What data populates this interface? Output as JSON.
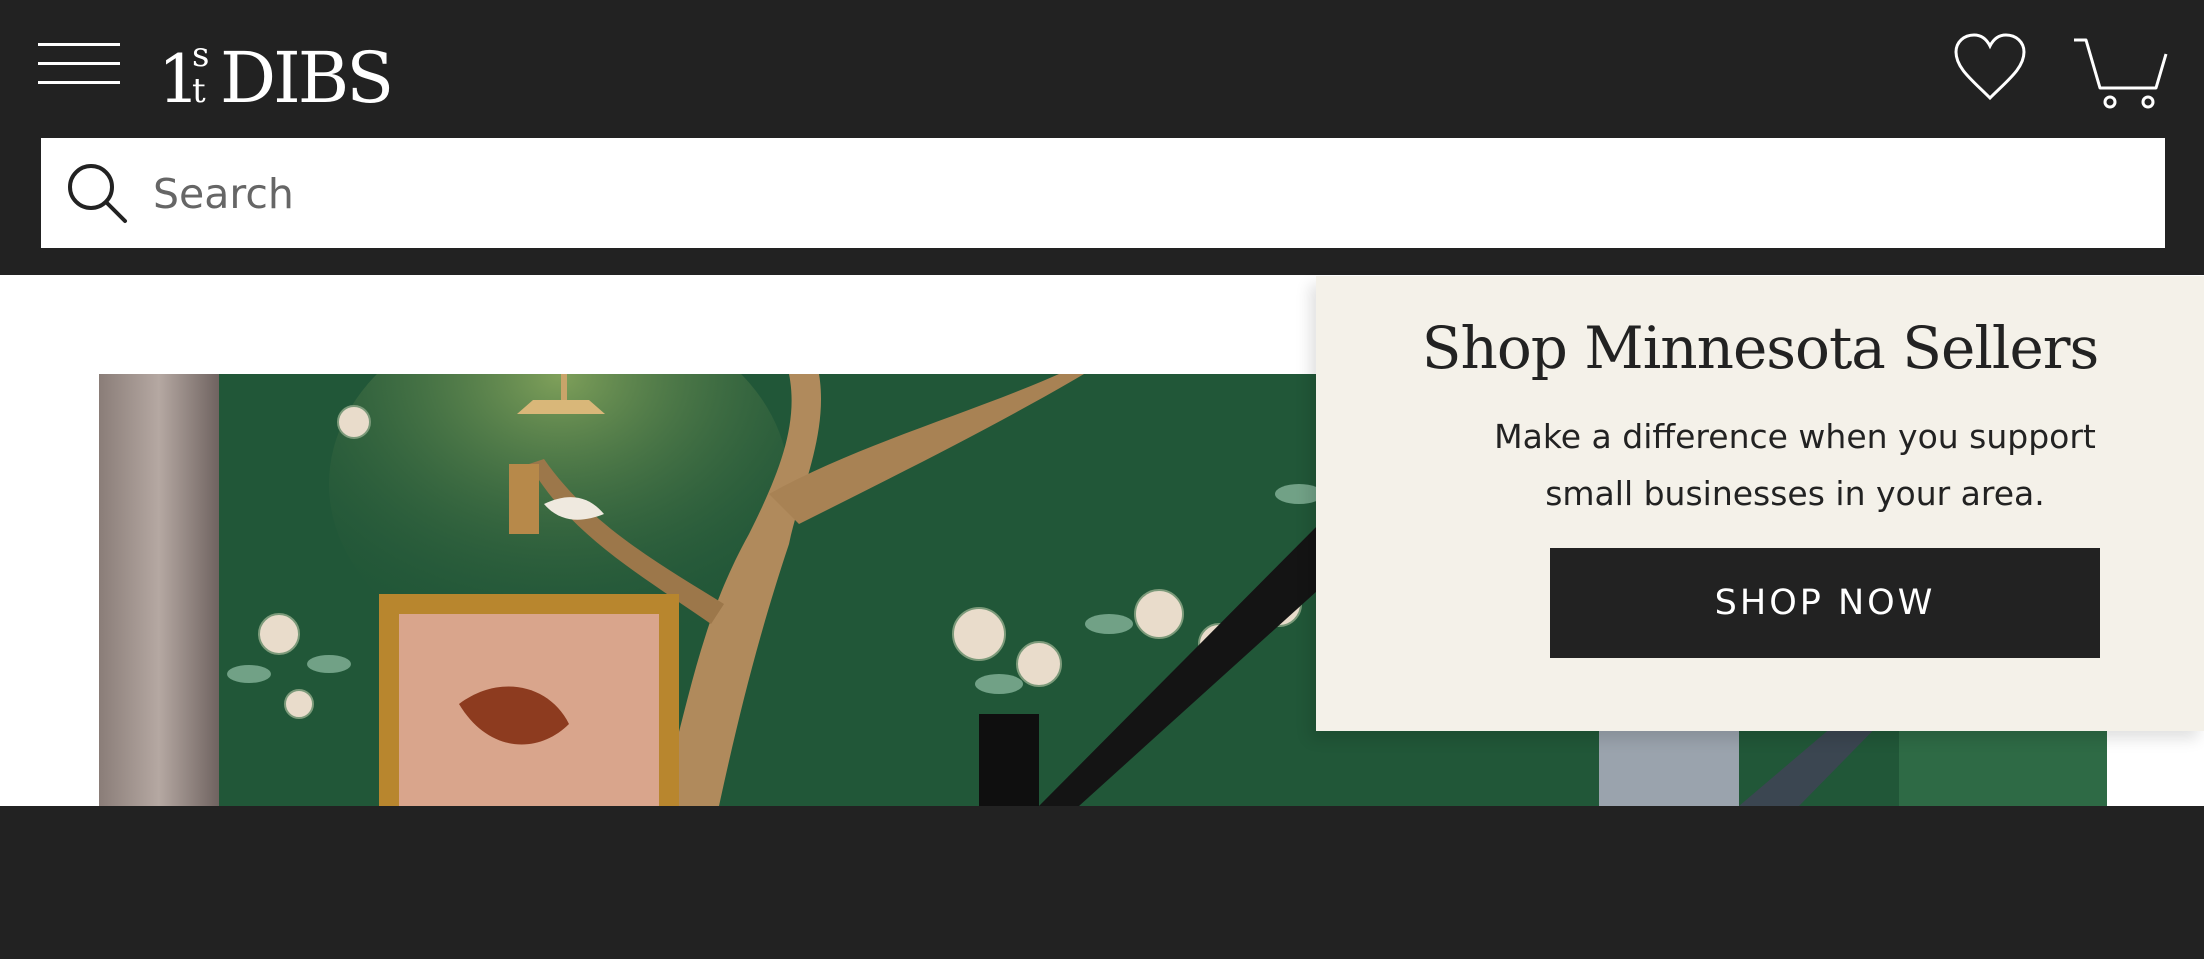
{
  "header": {
    "logo_text": "1stDIBS",
    "menu_icon": "hamburger-menu-icon",
    "favorites_icon": "heart-icon",
    "cart_icon": "shopping-cart-icon",
    "background_color": "#222222"
  },
  "search": {
    "placeholder": "Search",
    "icon": "search-icon"
  },
  "promo": {
    "title": "Shop Minnesota Sellers",
    "body": "Make a difference when you support small businesses in your area.",
    "button_label": "SHOP NOW",
    "background_color": "#f4f1e9"
  },
  "hero": {
    "image": "interior-staircase-with-green-floral-chinoiserie-wallpaper"
  }
}
